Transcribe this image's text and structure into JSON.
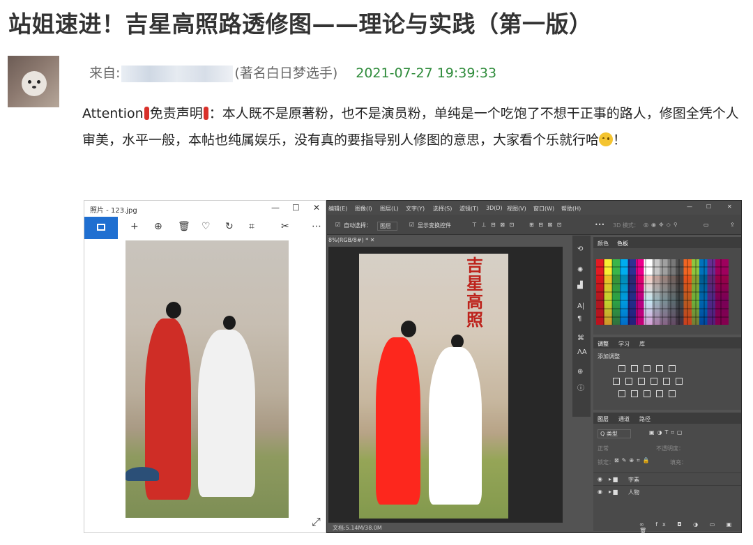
{
  "post": {
    "title": "站姐速进！吉星高照路透修图——理论与实践（第一版）",
    "from_label": "来自:",
    "author_suffix": "(著名白日梦选手)",
    "date": "2021-07-27 19:39:33",
    "body_attention": "Attention",
    "body_disclaimer": "免责声明",
    "body_part1": "：本人既不是原著粉，也不是演员粉，单纯是一个吃饱了不想干正事的路人，修图全凭个人审美，水平一般，本帖也纯属娱乐，没有真的要指导别人修图的意思，大家看个乐就行哈",
    "body_end": "！"
  },
  "photos_app": {
    "window_title": "照片 - 123.jpg",
    "window_controls": [
      "—",
      "☐",
      "✕"
    ],
    "toolbar": [
      "+",
      "⊕",
      "🗑",
      "♡",
      "↻",
      "⌗",
      "✂",
      "⋯"
    ],
    "expand_glyph": "⤢"
  },
  "photoshop": {
    "menu": [
      "编辑(E)",
      "图像(I)",
      "图层(L)",
      "文字(Y)",
      "选择(S)",
      "滤镜(T)",
      "3D(D)",
      "视图(V)",
      "窗口(W)",
      "帮助(H)"
    ],
    "options": {
      "auto_select": "自动选择：",
      "layer_select": "图层",
      "show_transform": "显示变换控件",
      "mode_3d": "3D 模式："
    },
    "doc_tab": "8%(RGB/8#) *",
    "status": "文档:5.14M/38.0M",
    "canvas_calligraphy": "吉星高照",
    "color_panel_tabs": [
      "颜色",
      "色板"
    ],
    "adjust_panel_tabs": [
      "调整",
      "学习",
      "库"
    ],
    "adjust_add": "添加调整",
    "layers_panel_tabs": [
      "图层",
      "通道",
      "路径"
    ],
    "layers_kind": "Q 类型",
    "layers_blend": "正常",
    "layers_opacity": "不透明度：",
    "layers_lock": "锁定：",
    "layers_fill": "填充：",
    "layers": [
      "字素",
      "人物"
    ]
  },
  "colors": {
    "accent_blue": "#1f6fd1",
    "date_green": "#2e8b3a",
    "alert_red": "#d9312b"
  }
}
